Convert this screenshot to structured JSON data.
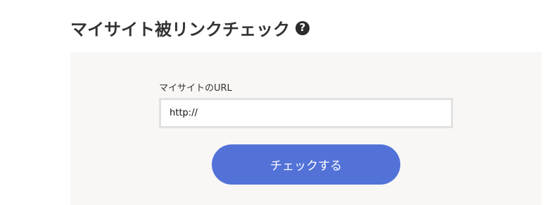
{
  "header": {
    "title": "マイサイト被リンクチェック",
    "help_icon": "question-circle-icon",
    "help_glyph": "?"
  },
  "form": {
    "url_label": "マイサイトのURL",
    "url_value": "http://",
    "submit_label": "チェックする"
  },
  "colors": {
    "panel_background": "#f8f7f6",
    "button_background": "#5272d8",
    "input_border": "#e2e1df",
    "title_text": "#333333"
  }
}
